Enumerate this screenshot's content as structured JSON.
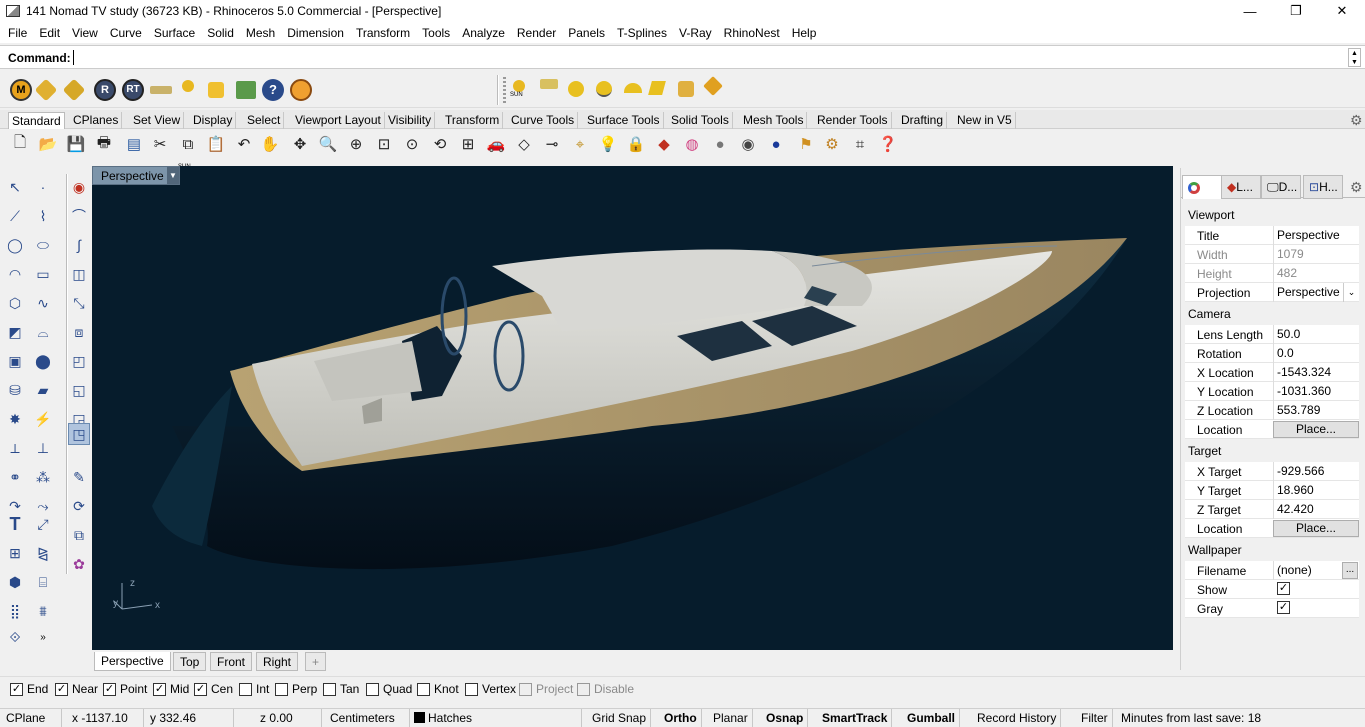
{
  "window": {
    "title": "141 Nomad TV study (36723 KB) - Rhinoceros 5.0 Commercial - [Perspective]",
    "controls": [
      "—",
      "❐",
      "✕"
    ]
  },
  "menu": [
    "File",
    "Edit",
    "View",
    "Curve",
    "Surface",
    "Solid",
    "Mesh",
    "Dimension",
    "Transform",
    "Tools",
    "Analyze",
    "Render",
    "Panels",
    "T-Splines",
    "V-Ray",
    "RhinoNest",
    "Help"
  ],
  "command": {
    "label": "Command:",
    "value": ""
  },
  "top_icons": {
    "sun_label_1": "SUN",
    "sun_label_2": "SUN",
    "icon_M": "M",
    "icon_R": "R",
    "icon_RT": "RT",
    "icon_help": "?"
  },
  "toolbar_tabs": [
    "Standard",
    "CPlanes",
    "Set View",
    "Display",
    "Select",
    "Viewport Layout",
    "Visibility",
    "Transform",
    "Curve Tools",
    "Surface Tools",
    "Solid Tools",
    "Mesh Tools",
    "Render Tools",
    "Drafting",
    "New in V5"
  ],
  "viewport": {
    "label": "Perspective",
    "axis_z": "z",
    "axis_y": "y",
    "axis_x": "x",
    "colors": {
      "background": "#061c2c",
      "hull": "#081a28",
      "deck": "#b09a70",
      "superstructure": "#d5d5d0"
    }
  },
  "viewport_tabs": [
    "Perspective",
    "Top",
    "Front",
    "Right",
    "+"
  ],
  "panel": {
    "tabs": [
      "L...",
      "D...",
      "H..."
    ],
    "viewport_section": "Viewport",
    "title_label": "Title",
    "title_value": "Perspective",
    "width_label": "Width",
    "width_value": "1079",
    "height_label": "Height",
    "height_value": "482",
    "projection_label": "Projection",
    "projection_value": "Perspective",
    "camera_section": "Camera",
    "lens_label": "Lens Length",
    "lens_value": "50.0",
    "rotation_label": "Rotation",
    "rotation_value": "0.0",
    "xloc_label": "X Location",
    "xloc_value": "-1543.324",
    "yloc_label": "Y Location",
    "yloc_value": "-1031.360",
    "zloc_label": "Z Location",
    "zloc_value": "553.789",
    "cam_location_label": "Location",
    "cam_place": "Place...",
    "target_section": "Target",
    "xt_label": "X Target",
    "xt_value": "-929.566",
    "yt_label": "Y Target",
    "yt_value": "18.960",
    "zt_label": "Z Target",
    "zt_value": "42.420",
    "tgt_location_label": "Location",
    "tgt_place": "Place...",
    "wallpaper_section": "Wallpaper",
    "filename_label": "Filename",
    "filename_value": "(none)",
    "filename_button": "...",
    "show_label": "Show",
    "gray_label": "Gray"
  },
  "osnaps": [
    {
      "label": "End",
      "checked": true
    },
    {
      "label": "Near",
      "checked": true
    },
    {
      "label": "Point",
      "checked": true
    },
    {
      "label": "Mid",
      "checked": true
    },
    {
      "label": "Cen",
      "checked": true
    },
    {
      "label": "Int",
      "checked": false
    },
    {
      "label": "Perp",
      "checked": false
    },
    {
      "label": "Tan",
      "checked": false
    },
    {
      "label": "Quad",
      "checked": false
    },
    {
      "label": "Knot",
      "checked": false
    },
    {
      "label": "Vertex",
      "checked": false
    },
    {
      "label": "Project",
      "checked": false
    },
    {
      "label": "Disable",
      "checked": false
    }
  ],
  "status": {
    "cplane": "CPlane",
    "x": "x -1137.10",
    "y": "y 332.46",
    "z": "z 0.00",
    "units": "Centimeters",
    "layer": "Hatches",
    "grid_snap": "Grid Snap",
    "ortho": "Ortho",
    "planar": "Planar",
    "osnap": "Osnap",
    "smarttrack": "SmartTrack",
    "gumball": "Gumball",
    "record_history": "Record History",
    "filter": "Filter",
    "last_save": "Minutes from last save: 18"
  }
}
